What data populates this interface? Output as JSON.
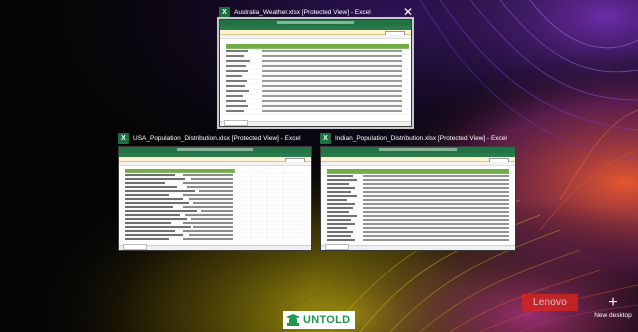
{
  "windows": [
    {
      "id": "australia",
      "icon": "excel-icon",
      "icon_letter": "X",
      "title": "Australia_Weather.xlsx  [Protected View] - Excel",
      "selected": true
    },
    {
      "id": "usa",
      "icon": "excel-icon",
      "icon_letter": "X",
      "title": "USA_Population_Distribution.xlsx  [Protected View] - Excel",
      "selected": false
    },
    {
      "id": "india",
      "icon": "excel-icon",
      "icon_letter": "X",
      "title": "Indian_Population_Distribution.xlsx  [Protected View] - Excel",
      "selected": false
    }
  ],
  "close": {
    "glyph": "✕",
    "icon": "close-icon"
  },
  "new_desktop": {
    "glyph": "+",
    "label": "New desktop"
  },
  "watermark": {
    "brand": "Lenovo"
  },
  "logo": {
    "word": "UNTOLD"
  },
  "colors": {
    "excel_green": "#217346",
    "lenovo_red": "#e2231a",
    "untold_green": "#1c9a4a"
  }
}
